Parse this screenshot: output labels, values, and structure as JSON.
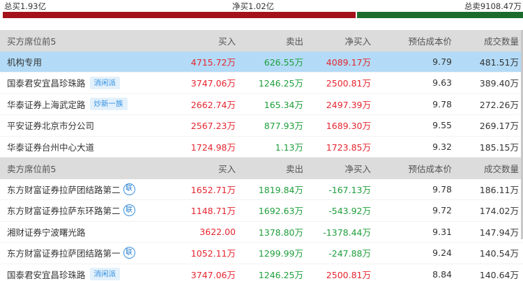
{
  "summary": {
    "total_buy": "总买1.93亿",
    "net_buy": "净买1.02亿",
    "total_sell": "总卖9108.47万",
    "buy_ratio": 0.678
  },
  "colors": {
    "buy_bar": "#a3111a",
    "sell_bar": "#1b6c2c",
    "up": "#e5252f",
    "down": "#1e9e3a",
    "highlight": "#b3dbf7",
    "tag": "#2e8ee0"
  },
  "buy_section": {
    "header": {
      "name": "买方席位前5",
      "buy": "买入",
      "sell": "卖出",
      "net": "净买入",
      "cost": "预估成本价",
      "vol": "成交数量"
    },
    "rows": [
      {
        "name": "机构专用",
        "tag": "",
        "lian": "",
        "buy": "4715.72万",
        "sell": "626.55万",
        "net": "4089.17万",
        "cost": "9.79",
        "vol": "481.51万"
      },
      {
        "name": "国泰君安宜昌珍珠路",
        "tag": "消闲派",
        "lian": "",
        "buy": "3747.06万",
        "sell": "1246.25万",
        "net": "2500.81万",
        "cost": "9.63",
        "vol": "389.40万"
      },
      {
        "name": "华泰证券上海武定路",
        "tag": "炒新一族",
        "lian": "",
        "buy": "2662.74万",
        "sell": "165.34万",
        "net": "2497.39万",
        "cost": "9.78",
        "vol": "272.26万"
      },
      {
        "name": "平安证券北京市分公司",
        "tag": "",
        "lian": "",
        "buy": "2567.23万",
        "sell": "877.93万",
        "net": "1689.30万",
        "cost": "9.55",
        "vol": "269.17万"
      },
      {
        "name": "华泰证券台州中心大道",
        "tag": "",
        "lian": "",
        "buy": "1724.98万",
        "sell": "1.13万",
        "net": "1723.85万",
        "cost": "9.32",
        "vol": "185.15万"
      }
    ]
  },
  "sell_section": {
    "header": {
      "name": "卖方席位前5",
      "buy": "买入",
      "sell": "卖出",
      "net": "净买入",
      "cost": "预估成本价",
      "vol": "成交数量"
    },
    "rows": [
      {
        "name": "东方财富证券拉萨团结路第二",
        "tag": "",
        "lian": "联",
        "buy": "1652.71万",
        "sell": "1819.84万",
        "net": "-167.13万",
        "cost": "9.78",
        "vol": "186.11万"
      },
      {
        "name": "东方财富证券拉萨东环路第二",
        "tag": "",
        "lian": "联",
        "buy": "1148.71万",
        "sell": "1692.63万",
        "net": "-543.92万",
        "cost": "9.72",
        "vol": "174.02万"
      },
      {
        "name": "湘财证券宁波曙光路",
        "tag": "",
        "lian": "",
        "buy": "3622.00",
        "sell": "1378.80万",
        "net": "-1378.44万",
        "cost": "9.31",
        "vol": "147.94万"
      },
      {
        "name": "东方财富证券拉萨团结路第一",
        "tag": "",
        "lian": "联",
        "buy": "1052.11万",
        "sell": "1299.99万",
        "net": "-247.88万",
        "cost": "9.24",
        "vol": "140.54万"
      },
      {
        "name": "国泰君安宜昌珍珠路",
        "tag": "消闲派",
        "lian": "",
        "buy": "3747.06万",
        "sell": "1246.25万",
        "net": "2500.81万",
        "cost": "8.84",
        "vol": "140.64万"
      }
    ]
  }
}
